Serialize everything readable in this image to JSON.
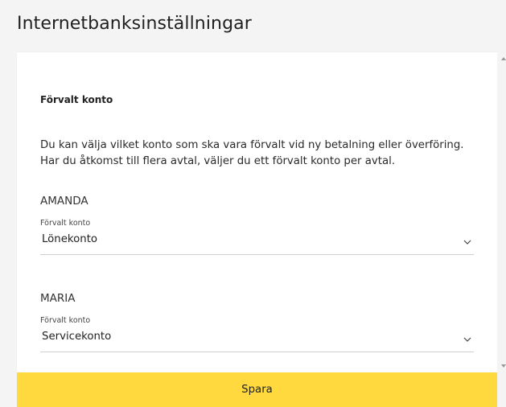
{
  "page": {
    "title": "Internetbanksinställningar"
  },
  "settings": {
    "heading": "Förvalt konto",
    "intro": "Du kan välja vilket konto som ska vara förvalt vid ny betalning eller överföring. Har du åtkomst till flera avtal, väljer du ett förvalt konto per avtal.",
    "agreements": [
      {
        "name": "AMANDA",
        "field_label": "Förvalt konto",
        "selected_account": "Lönekonto"
      },
      {
        "name": "MARIA",
        "field_label": "Förvalt konto",
        "selected_account": "Servicekonto"
      }
    ]
  },
  "actions": {
    "save_label": "Spara"
  },
  "icons": {
    "select_chevron": "chevron-down-icon",
    "scroll_up": "scroll-up-arrow-icon",
    "scroll_down": "scroll-down-arrow-icon"
  },
  "colors": {
    "save_button": "#ffd93d",
    "panel_background": "#ffffff",
    "page_background": "#f4f4f4",
    "divider": "#cfcfcf"
  }
}
